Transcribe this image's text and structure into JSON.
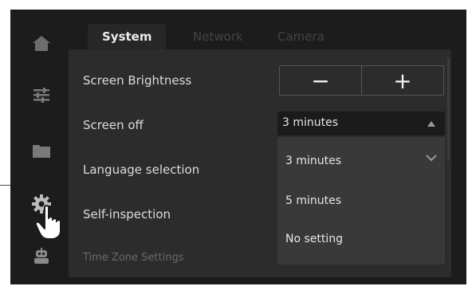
{
  "nav": {
    "items": [
      {
        "icon": "home-icon"
      },
      {
        "icon": "sliders-icon"
      },
      {
        "icon": "folder-icon"
      },
      {
        "icon": "gear-icon"
      },
      {
        "icon": "robot-icon"
      }
    ],
    "active_index": 3
  },
  "tabs": [
    {
      "label": "System",
      "active": true
    },
    {
      "label": "Network",
      "active": false
    },
    {
      "label": "Camera",
      "active": false
    }
  ],
  "settings": {
    "brightness": {
      "label": "Screen Brightness",
      "minus": "−",
      "plus": "+"
    },
    "screen_off": {
      "label": "Screen off",
      "value": "3 minutes"
    },
    "language": {
      "label": "Language selection"
    },
    "self_inspection": {
      "label": "Self-inspection"
    },
    "time_zone": {
      "label": "Time Zone Settings"
    }
  },
  "dropdown": {
    "options": [
      "3 minutes",
      "5 minutes",
      "No setting"
    ],
    "selected": "3 minutes"
  },
  "colors": {
    "background": "#1c1c1c",
    "panel": "#2c2c2c",
    "dropdown": "#393939",
    "text": "#dcdcdc"
  },
  "pointer": "hand-pointer-icon"
}
